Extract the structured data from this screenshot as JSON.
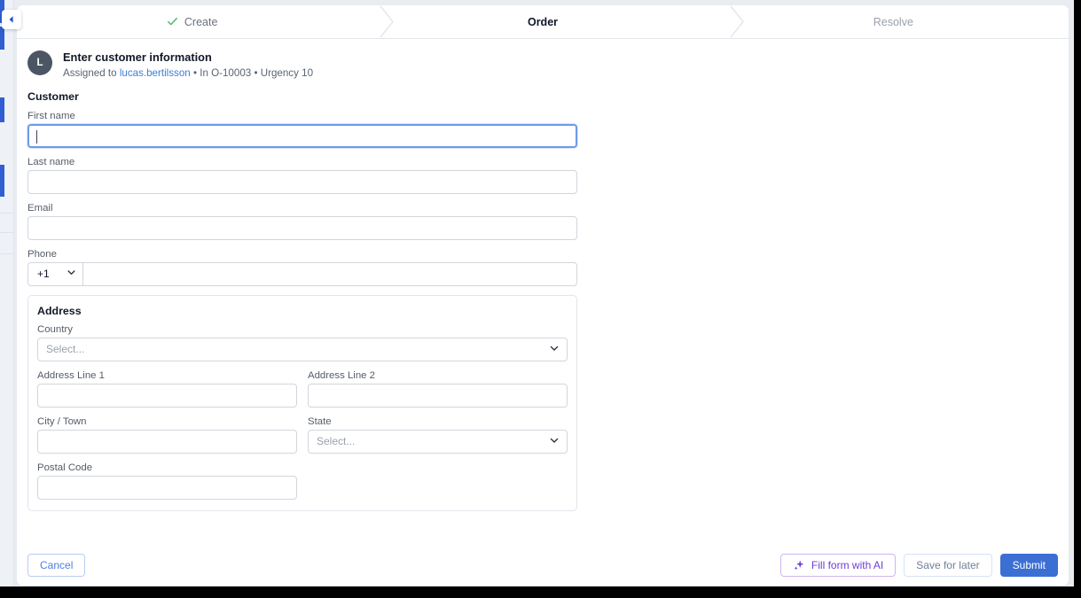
{
  "window": {
    "frame_color": "#000000",
    "page_background": "#e9ecf1"
  },
  "left_rail": {
    "collapse_icon": "chevron-left-icon",
    "accent_color": "#2f5fd0"
  },
  "stepper": {
    "steps": [
      {
        "label": "Create",
        "state": "done",
        "icon": "check-icon"
      },
      {
        "label": "Order",
        "state": "current",
        "icon": ""
      },
      {
        "label": "Resolve",
        "state": "todo",
        "icon": ""
      }
    ],
    "done_color": "#6b7280",
    "current_color": "#0f172a",
    "todo_color": "#9aa1ac",
    "check_color": "#56b870"
  },
  "task": {
    "avatar_initial": "L",
    "avatar_color": "#4b5563",
    "title": "Enter customer information",
    "meta_prefix": "Assigned to ",
    "assignee": "lucas.bertilsson",
    "meta_suffix": " • In O-10003 • Urgency 10",
    "assignee_color": "#3b7fd6"
  },
  "form": {
    "section_title": "Customer",
    "first_name": {
      "label": "First name",
      "value": "",
      "placeholder": "",
      "focused": true
    },
    "last_name": {
      "label": "Last name",
      "value": "",
      "placeholder": ""
    },
    "email": {
      "label": "Email",
      "value": "",
      "placeholder": ""
    },
    "phone": {
      "label": "Phone",
      "country_code": "+1",
      "value": "",
      "placeholder": "",
      "chevron_icon": "chevron-down-icon"
    },
    "address": {
      "title": "Address",
      "country": {
        "label": "Country",
        "value": "Select...",
        "is_placeholder": true,
        "chevron_icon": "chevron-down-icon"
      },
      "line1": {
        "label": "Address Line 1",
        "value": ""
      },
      "line2": {
        "label": "Address Line 2",
        "value": ""
      },
      "city": {
        "label": "City / Town",
        "value": ""
      },
      "state": {
        "label": "State",
        "value": "Select...",
        "is_placeholder": true,
        "chevron_icon": "chevron-down-icon"
      },
      "postal_code": {
        "label": "Postal Code",
        "value": ""
      }
    }
  },
  "footer": {
    "cancel_label": "Cancel",
    "fill_ai_label": "Fill form with AI",
    "fill_ai_icon": "sparkle-icon",
    "save_label": "Save for later",
    "submit_label": "Submit",
    "submit_color": "#3b6fd4",
    "ai_color": "#6d3fd4"
  }
}
